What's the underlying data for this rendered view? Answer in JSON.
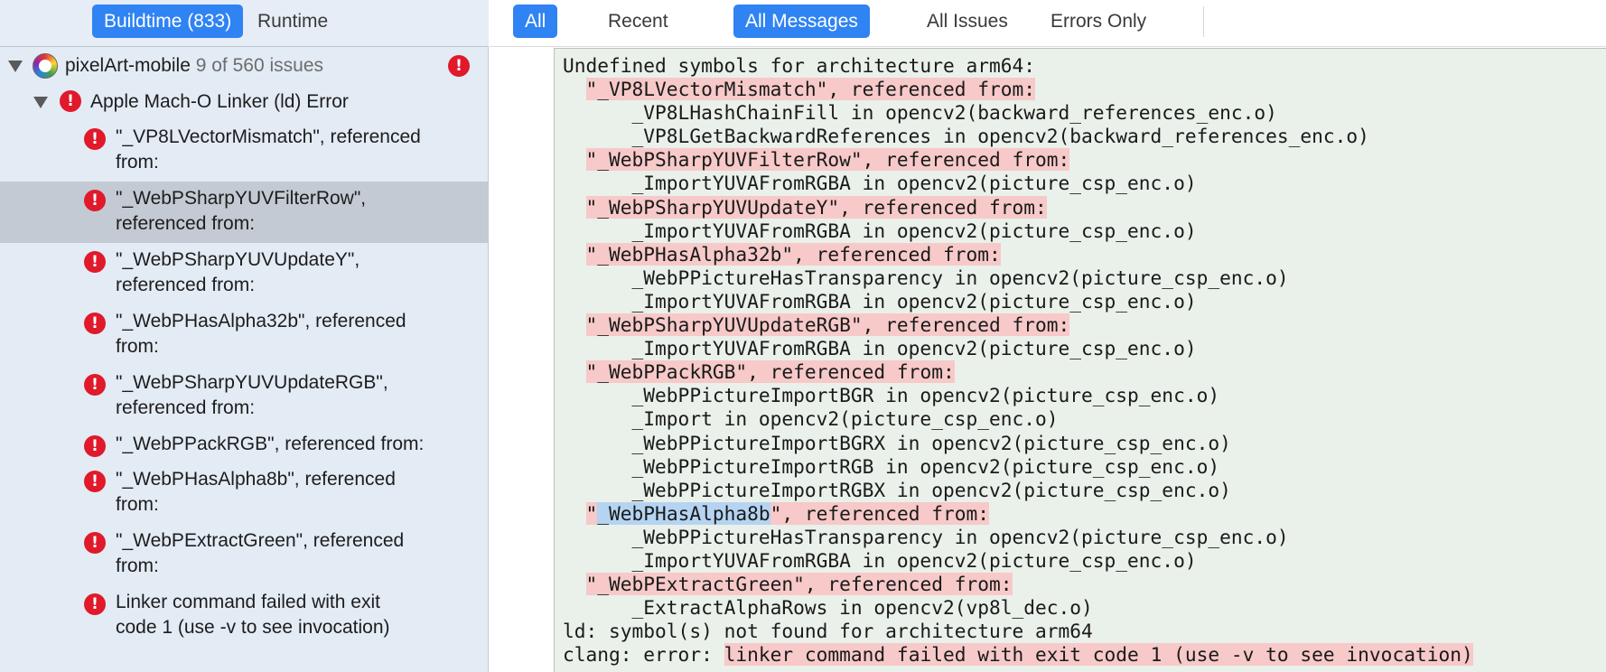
{
  "left_header": {
    "tab_buildtime": "Buildtime (833)",
    "tab_runtime": "Runtime"
  },
  "right_header": {
    "filter_all": "All",
    "filter_recent": "Recent",
    "filter_all_messages": "All Messages",
    "filter_all_issues": "All Issues",
    "filter_errors_only": "Errors Only"
  },
  "tree": {
    "project": {
      "name": "pixelArt-mobile",
      "count": "9 of 560 issues",
      "icon": "app-icon"
    },
    "group": {
      "label": "Apple Mach-O Linker (ld) Error"
    },
    "items": [
      {
        "line1": "\"_VP8LVectorMismatch\", referenced",
        "line2": "from:"
      },
      {
        "line1": "\"_WebPSharpYUVFilterRow\",",
        "line2": "referenced from:"
      },
      {
        "line1": "\"_WebPSharpYUVUpdateY\",",
        "line2": "referenced from:"
      },
      {
        "line1": "\"_WebPHasAlpha32b\", referenced",
        "line2": "from:"
      },
      {
        "line1": "\"_WebPSharpYUVUpdateRGB\",",
        "line2": "referenced from:"
      },
      {
        "line1": "\"_WebPPackRGB\", referenced from:",
        "line2": ""
      },
      {
        "line1": "\"_WebPHasAlpha8b\", referenced",
        "line2": "from:"
      },
      {
        "line1": "\"_WebPExtractGreen\", referenced",
        "line2": "from:"
      },
      {
        "line1": "Linker command failed with exit",
        "line2": "code 1 (use -v to see invocation)"
      }
    ],
    "selected_index": 1
  },
  "log": {
    "lines": [
      {
        "pre": "Undefined symbols for architecture arm64:",
        "hl": "",
        "post": ""
      },
      {
        "pre": "  ",
        "hl": "\"_VP8LVectorMismatch\", referenced from:",
        "post": ""
      },
      {
        "pre": "      _VP8LHashChainFill in opencv2(backward_references_enc.o)",
        "hl": "",
        "post": ""
      },
      {
        "pre": "      _VP8LGetBackwardReferences in opencv2(backward_references_enc.o)",
        "hl": "",
        "post": ""
      },
      {
        "pre": "  ",
        "hl": "\"_WebPSharpYUVFilterRow\", referenced from:",
        "post": ""
      },
      {
        "pre": "      _ImportYUVAFromRGBA in opencv2(picture_csp_enc.o)",
        "hl": "",
        "post": ""
      },
      {
        "pre": "  ",
        "hl": "\"_WebPSharpYUVUpdateY\", referenced from:",
        "post": ""
      },
      {
        "pre": "      _ImportYUVAFromRGBA in opencv2(picture_csp_enc.o)",
        "hl": "",
        "post": ""
      },
      {
        "pre": "  ",
        "hl": "\"_WebPHasAlpha32b\", referenced from:",
        "post": ""
      },
      {
        "pre": "      _WebPPictureHasTransparency in opencv2(picture_csp_enc.o)",
        "hl": "",
        "post": ""
      },
      {
        "pre": "      _ImportYUVAFromRGBA in opencv2(picture_csp_enc.o)",
        "hl": "",
        "post": ""
      },
      {
        "pre": "  ",
        "hl": "\"_WebPSharpYUVUpdateRGB\", referenced from:",
        "post": ""
      },
      {
        "pre": "      _ImportYUVAFromRGBA in opencv2(picture_csp_enc.o)",
        "hl": "",
        "post": ""
      },
      {
        "pre": "  ",
        "hl": "\"_WebPPackRGB\", referenced from:",
        "post": ""
      },
      {
        "pre": "      _WebPPictureImportBGR in opencv2(picture_csp_enc.o)",
        "hl": "",
        "post": ""
      },
      {
        "pre": "      _Import in opencv2(picture_csp_enc.o)",
        "hl": "",
        "post": ""
      },
      {
        "pre": "      _WebPPictureImportBGRX in opencv2(picture_csp_enc.o)",
        "hl": "",
        "post": ""
      },
      {
        "pre": "      _WebPPictureImportRGB in opencv2(picture_csp_enc.o)",
        "hl": "",
        "post": ""
      },
      {
        "pre": "      _WebPPictureImportRGBX in opencv2(picture_csp_enc.o)",
        "hl": "",
        "post": ""
      },
      {
        "pre": "  ",
        "hl": "\"",
        "sel": "_WebPHasAlpha8b",
        "hl2": "\", referenced from:",
        "post": ""
      },
      {
        "pre": "      _WebPPictureHasTransparency in opencv2(picture_csp_enc.o)",
        "hl": "",
        "post": ""
      },
      {
        "pre": "      _ImportYUVAFromRGBA in opencv2(picture_csp_enc.o)",
        "hl": "",
        "post": ""
      },
      {
        "pre": "  ",
        "hl": "\"_WebPExtractGreen\", referenced from:",
        "post": ""
      },
      {
        "pre": "      _ExtractAlphaRows in opencv2(vp8l_dec.o)",
        "hl": "",
        "post": ""
      },
      {
        "pre": "ld: symbol(s) not found for architecture arm64",
        "hl": "",
        "post": ""
      },
      {
        "pre": "clang: error: ",
        "hl": "linker command failed with exit code 1 (use -v to see invocation)",
        "post": ""
      }
    ]
  },
  "colors": {
    "accent": "#2f83f3",
    "error": "#e0192b",
    "highlight": "#f7c9c9",
    "selection": "#b5d4f2",
    "sidebar_bg": "#e3ebf5",
    "log_bg": "#eaf0ea"
  }
}
